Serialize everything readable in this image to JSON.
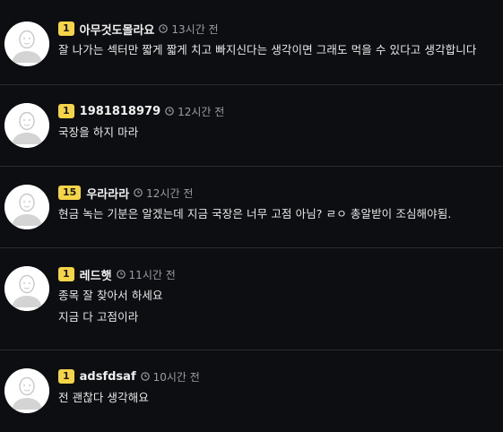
{
  "colors": {
    "background": "#0d0e12",
    "level_badge": "#f5d547",
    "divider": "#2a2b30",
    "time_text": "#9a9ca3"
  },
  "comments": [
    {
      "level": "1",
      "nickname": "아무것도몰라요",
      "time": "13시간 전",
      "avatar_icon": "default-user-avatar",
      "lines": [
        "잘 나가는 섹터만 짧게 짧게 치고 빠지신다는 생각이면 그래도 먹을 수 있다고 생각합니다"
      ]
    },
    {
      "level": "1",
      "nickname": "1981818979",
      "time": "12시간 전",
      "avatar_icon": "default-user-avatar",
      "lines": [
        "국장을 하지 마라"
      ]
    },
    {
      "level": "15",
      "nickname": "우라라라",
      "time": "12시간 전",
      "avatar_icon": "default-user-avatar",
      "lines": [
        "현금 녹는 기분은 알겠는데 지금 국장은 너무 고점 아님? ㄹㅇ 총알받이 조심해야됨."
      ]
    },
    {
      "level": "1",
      "nickname": "레드햇",
      "time": "11시간 전",
      "avatar_icon": "default-user-avatar",
      "lines": [
        "종목 잘 찾아서 하세요",
        "지금 다 고점이라"
      ]
    },
    {
      "level": "1",
      "nickname": "adsfdsaf",
      "time": "10시간 전",
      "avatar_icon": "default-user-avatar",
      "lines": [
        "전 괜찮다 생각해요"
      ]
    }
  ]
}
